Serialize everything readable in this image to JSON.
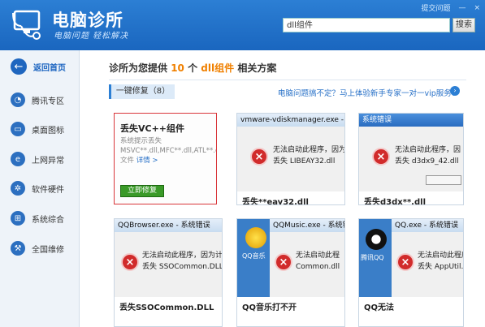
{
  "app": {
    "title": "电脑诊所",
    "slogan": "电脑问题 轻松解决",
    "top_links": [
      "提交问题",
      "—",
      "×"
    ]
  },
  "search": {
    "value": "dll组件",
    "button": "搜索"
  },
  "sidebar": {
    "items": [
      {
        "label": "返回首页",
        "icon": "back-arrow-icon",
        "glyph": "←"
      },
      {
        "label": "腾讯专区",
        "icon": "bell-icon",
        "glyph": "◔"
      },
      {
        "label": "桌面图标",
        "icon": "monitor-icon",
        "glyph": "▭"
      },
      {
        "label": "上网异常",
        "icon": "ie-icon",
        "glyph": "e"
      },
      {
        "label": "软件硬件",
        "icon": "gear-icon",
        "glyph": "✲"
      },
      {
        "label": "系统综合",
        "icon": "windows-icon",
        "glyph": "⊞"
      },
      {
        "label": "全国维修",
        "icon": "wrench-icon",
        "glyph": "⚒"
      }
    ]
  },
  "main": {
    "headline_prefix": "诊所为您提供",
    "headline_count": "10",
    "headline_unit": "个",
    "headline_keyword": "dll组件",
    "headline_suffix": "相关方案",
    "section_label": "一键修复（8）",
    "section_link": "电脑问题搞不定？马上体验新手专家一对一vip服务！",
    "fix_card": {
      "title": "丢失VC++组件",
      "desc": "系统提示丢失MSVC**.dll,MFC**.dll,ATL**.dll文件",
      "more": "详情 >",
      "button": "立即修复"
    },
    "cards": [
      {
        "window_title": "vmware-vdiskmanager.exe -",
        "line1": "无法启动此程序，因为",
        "line2": "丢失 LIBEAY32.dll",
        "caption": "丢失**eay32.dll"
      },
      {
        "window_title": "系统错误",
        "line1": "无法启动此程序，因",
        "line2": "丢失 d3dx9_42.dll",
        "caption": "丢失d3dx**.dll"
      },
      {
        "window_title": "QQBrowser.exe - 系统错误",
        "line1": "无法启动此程序，因为计",
        "line2": "丢失 SSOCommon.DLL",
        "caption": "丢失SSOCommon.DLL"
      },
      {
        "window_title": "QQMusic.exe - 系统错",
        "line1": "无法启动此程",
        "line2": "Common.dll",
        "caption": "QQ音乐打不开",
        "desktop_label": "QQ音乐"
      },
      {
        "window_title": "QQ.exe - 系统错误",
        "line1": "无法启动此程序",
        "line2": "丢失 AppUtil.dl",
        "caption": "QQ无法",
        "desktop_label": "腾讯QQ"
      }
    ]
  },
  "colors": {
    "header": "#1a66bf",
    "accent": "#f08000",
    "fix_button": "#3a9a28",
    "error_icon": "#d12b2b"
  }
}
